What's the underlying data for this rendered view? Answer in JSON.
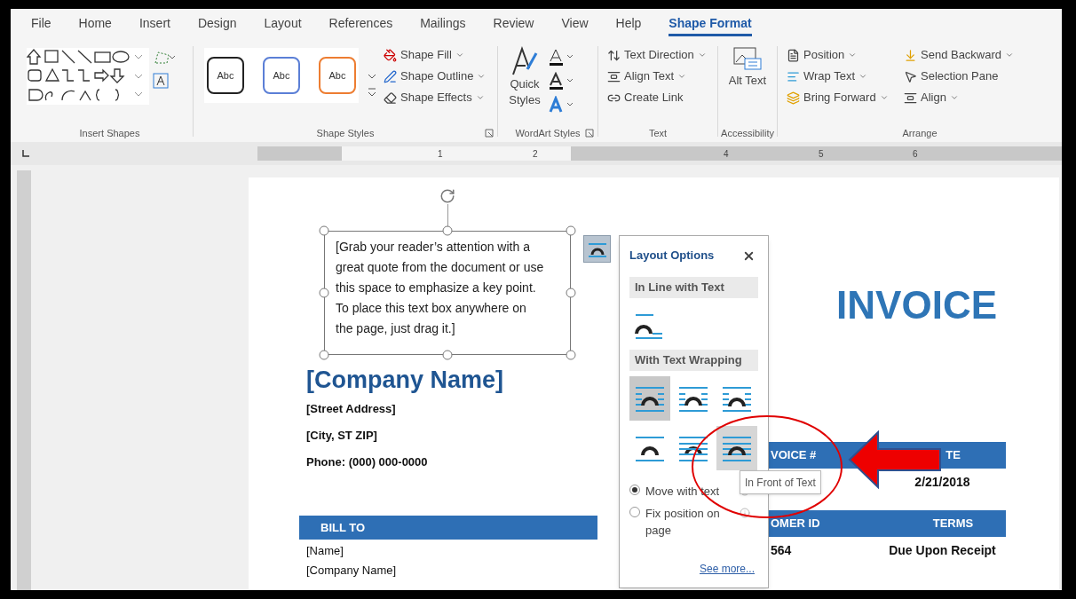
{
  "tabs": [
    {
      "label": "File",
      "selected": false
    },
    {
      "label": "Home",
      "selected": false
    },
    {
      "label": "Insert",
      "selected": false
    },
    {
      "label": "Design",
      "selected": false
    },
    {
      "label": "Layout",
      "selected": false
    },
    {
      "label": "References",
      "selected": false
    },
    {
      "label": "Mailings",
      "selected": false
    },
    {
      "label": "Review",
      "selected": false
    },
    {
      "label": "View",
      "selected": false
    },
    {
      "label": "Help",
      "selected": false
    },
    {
      "label": "Shape Format",
      "selected": true
    }
  ],
  "ribbon": {
    "insert_shapes": {
      "label": "Insert Shapes"
    },
    "shape_styles": {
      "label": "Shape Styles",
      "presets": [
        {
          "label": "Abc",
          "color": "#222222"
        },
        {
          "label": "Abc",
          "color": "#5b7fd6"
        },
        {
          "label": "Abc",
          "color": "#ed7d31"
        }
      ],
      "commands": [
        {
          "kind": "fill",
          "label": "Shape Fill"
        },
        {
          "kind": "outline",
          "label": "Shape Outline"
        },
        {
          "kind": "effects",
          "label": "Shape Effects"
        }
      ]
    },
    "wordart_styles": {
      "label": "WordArt Styles",
      "quick_styles": "Quick Styles"
    },
    "text": {
      "label": "Text",
      "commands": [
        {
          "kind": "direction",
          "label": "Text Direction",
          "dropdown": true
        },
        {
          "kind": "align",
          "label": "Align Text",
          "dropdown": true
        },
        {
          "kind": "link",
          "label": "Create Link",
          "dropdown": false
        }
      ]
    },
    "accessibility": {
      "label": "Accessibility",
      "alt_text": "Alt Text"
    },
    "arrange": {
      "label": "Arrange",
      "commands": [
        {
          "kind": "position",
          "label": "Position",
          "dropdown": true
        },
        {
          "kind": "send-backward",
          "label": "Send Backward",
          "dropdown": true
        },
        {
          "kind": "wrap",
          "label": "Wrap Text",
          "dropdown": true
        },
        {
          "kind": "selection-pane",
          "label": "Selection Pane",
          "dropdown": false
        },
        {
          "kind": "bring-forward",
          "label": "Bring Forward",
          "dropdown": true
        },
        {
          "kind": "align",
          "label": "Align",
          "dropdown": true
        }
      ]
    }
  },
  "ruler": {
    "marks": [
      "1",
      "2",
      "4",
      "5",
      "6"
    ]
  },
  "document": {
    "text_box": "[Grab your reader’s attention with a great quote from the document or use this space to emphasize a key point. To place this text box anywhere on the page, just drag it.]",
    "company_name": "[Company Name]",
    "address_lines": [
      "[Street Address]",
      "[City, ST ZIP]",
      "Phone: (000) 000-0000"
    ],
    "title": "INVOICE",
    "bill_to": {
      "header": "BILL TO",
      "lines": [
        "[Name]",
        "[Company Name]"
      ]
    },
    "details": [
      {
        "columns": [
          {
            "header": "VOICE #"
          },
          {
            "header": "TE",
            "value": "2/21/2018"
          }
        ]
      },
      {
        "columns": [
          {
            "header": "OMER ID",
            "value": "564"
          },
          {
            "header": "TERMS",
            "value": "Due Upon Receipt"
          }
        ]
      }
    ]
  },
  "layout_options": {
    "title": "Layout Options",
    "inline_section": "In Line with Text",
    "inline_option": {
      "kind": "inline",
      "selected": false,
      "highlighted": false
    },
    "wrapping_section": "With Text Wrapping",
    "wrapping_options": [
      {
        "kind": "square",
        "selected": true,
        "highlighted": false
      },
      {
        "kind": "tight",
        "selected": false,
        "highlighted": false
      },
      {
        "kind": "through",
        "selected": false,
        "highlighted": false
      },
      {
        "kind": "top-bottom",
        "selected": false,
        "highlighted": false
      },
      {
        "kind": "behind",
        "selected": false,
        "highlighted": false
      },
      {
        "kind": "front",
        "selected": false,
        "highlighted": true
      }
    ],
    "positions": [
      {
        "label": "Move with text",
        "selected": true
      },
      {
        "label": "Fix position on page",
        "selected": false
      }
    ],
    "see_more": "See more...",
    "tooltip": "In Front of Text"
  }
}
